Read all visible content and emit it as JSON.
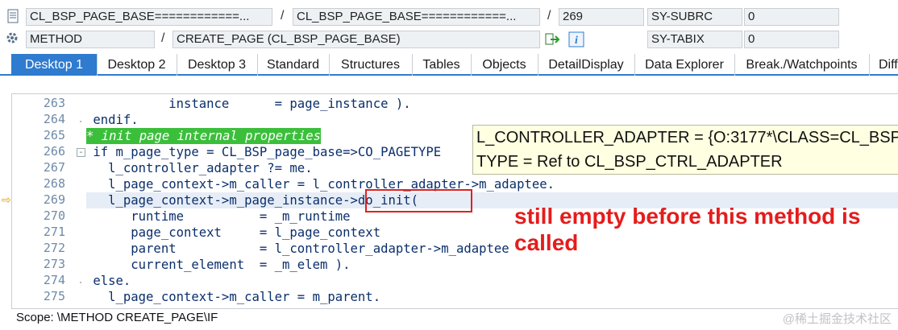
{
  "header": {
    "row1": {
      "program_main": "CL_BSP_PAGE_BASE============...",
      "separator1": "/",
      "program_include": "CL_BSP_PAGE_BASE============...",
      "separator2": "/",
      "line": "269",
      "sy_var": "SY-SUBRC",
      "sy_value": "0"
    },
    "row2": {
      "event_type": "METHOD",
      "separator": "/",
      "event_name": "CREATE_PAGE (CL_BSP_PAGE_BASE)",
      "sy_var": "SY-TABIX",
      "sy_value": "0"
    }
  },
  "tabs": [
    {
      "label": "Desktop 1",
      "active": true
    },
    {
      "label": "Desktop 2"
    },
    {
      "label": "Desktop 3"
    },
    {
      "label": "Standard"
    },
    {
      "label": "Structures"
    },
    {
      "label": "Tables"
    },
    {
      "label": "Objects"
    },
    {
      "label": "DetailDisplay"
    },
    {
      "label": "Data Explorer"
    },
    {
      "label": "Break./Watchpoints"
    },
    {
      "label": "Diff"
    }
  ],
  "code": {
    "line_numbers": [
      "263",
      "264",
      "265",
      "266",
      "267",
      "268",
      "269",
      "270",
      "271",
      "272",
      "273",
      "274",
      "275"
    ],
    "lines": [
      "                instance      = page_instance ).",
      "      endif.",
      "* init page internal properties",
      "      if m_page_type = CL_BSP_page_base=>CO_PAGETYPE",
      "        l_controller_adapter ?= me.",
      "        l_page_context->m_caller = l_controller_adapter->m_adaptee.",
      "        l_page_context->m_page_instance->do_init(",
      "           runtime          = _m_runtime",
      "           page_context     = l_page_context",
      "           parent           = l_controller_adapter->m_adaptee",
      "           current_element  = _m_elem ).",
      "      else.",
      "        l_page_context->m_caller = m_parent."
    ]
  },
  "tooltip": {
    "line1": "L_CONTROLLER_ADAPTER = {O:3177*\\CLASS=CL_BSP",
    "line2": "TYPE  = Ref to CL_BSP_CTRL_ADAPTER"
  },
  "annotation": "still empty before this method is\ncalled",
  "status": {
    "scope": "Scope: \\METHOD CREATE_PAGE\\IF"
  },
  "watermark": "@稀土掘金技术社区",
  "colors": {
    "accent": "#2e7bcf",
    "comment_bg": "#3bbf3b",
    "annotation": "#e51c1c",
    "tooltip_bg": "#ffffe1"
  }
}
